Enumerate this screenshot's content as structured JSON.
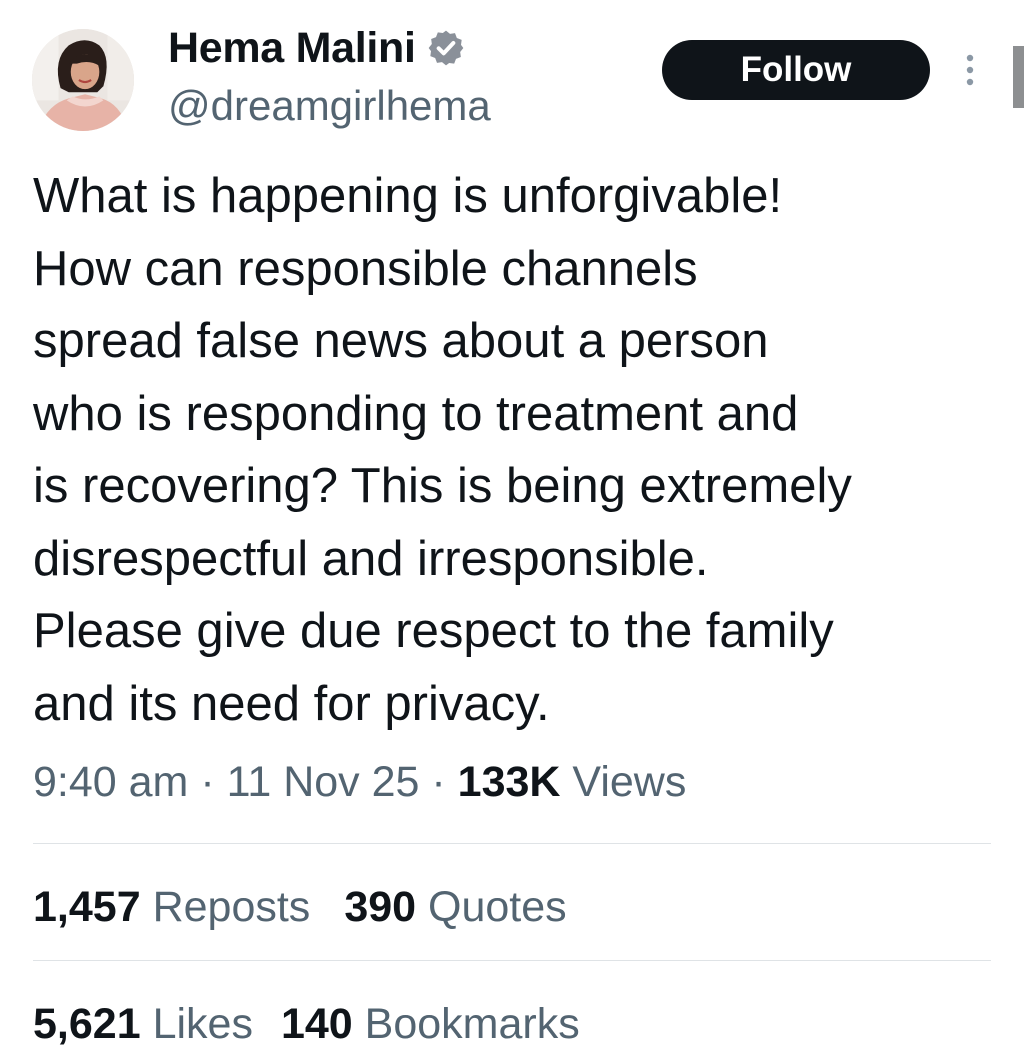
{
  "author": {
    "display_name": "Hema Malini",
    "handle": "@dreamgirlhema",
    "verified_icon": "verified-badge-icon"
  },
  "follow_button": {
    "label": "Follow"
  },
  "tweet": {
    "text": "What is happening is unforgivable!\nHow can responsible channels\nspread false news about a person\nwho is responding to treatment and\nis recovering? This is being extremely\ndisrespectful and  irresponsible.\nPlease give due respect to the family\nand its need for privacy.",
    "time": "9:40 am",
    "date": "11 Nov 25",
    "views_count": "133K",
    "views_label": "Views",
    "separator": "·"
  },
  "engagement": {
    "reposts_count": "1,457",
    "reposts_label": "Reposts",
    "quotes_count": "390",
    "quotes_label": "Quotes",
    "likes_count": "5,621",
    "likes_label": "Likes",
    "bookmarks_count": "140",
    "bookmarks_label": "Bookmarks"
  },
  "colors": {
    "text_primary": "#0f1419",
    "text_secondary": "#536471",
    "button_bg": "#0f1419",
    "divider": "#dfe3e6"
  }
}
